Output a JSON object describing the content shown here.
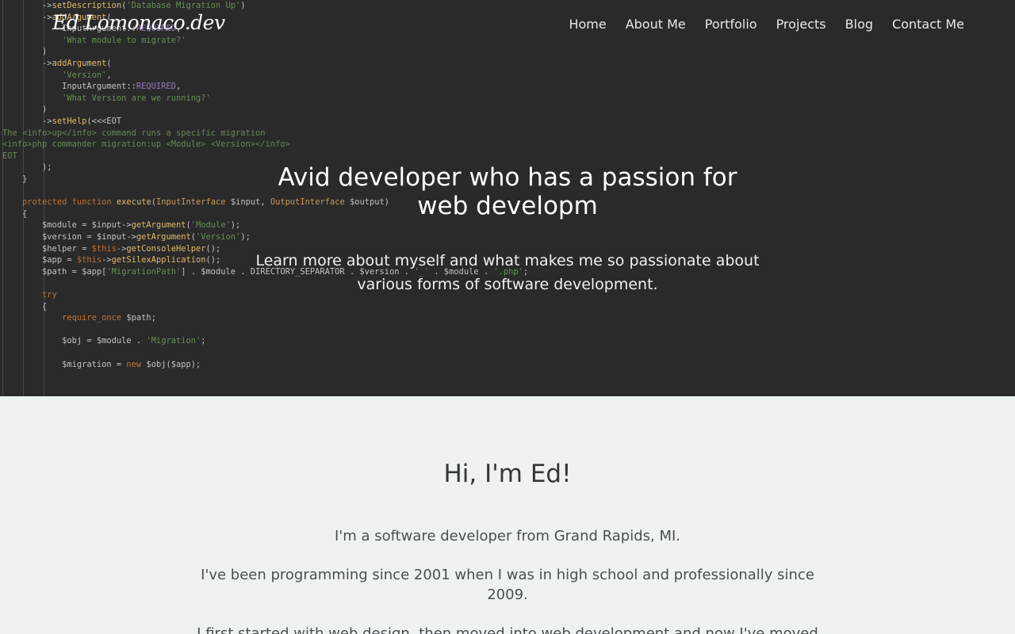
{
  "header": {
    "logo": "Ed Lomonaco.dev",
    "nav": [
      "Home",
      "About Me",
      "Portfolio",
      "Projects",
      "Blog",
      "Contact Me"
    ]
  },
  "hero": {
    "title": "Avid developer who has a passion for web developm",
    "subtitle": "Learn more about myself and what makes me so passionate about various forms of software development."
  },
  "about": {
    "heading": "Hi, I'm Ed!",
    "paragraphs": [
      "I'm a software developer from Grand Rapids, MI.",
      "I've been programming since 2001 when I was in high school and professionally since 2009.",
      "I first started with web design, then moved into web development and now I've moved onto"
    ]
  },
  "code": [
    "        ->setDescription('Database Migration Up')",
    "        ->addArgument(",
    "            InputArgument::REQUIRED,",
    "            'What module to migrate?'",
    "        )",
    "        ->addArgument(",
    "            'Version',",
    "            InputArgument::REQUIRED,",
    "            'What Version are we running?'",
    "        )",
    "        ->setHelp(<<<EOT",
    "The <info>up</info> command runs a specific migration",
    "<info>php commander migration:up <Module> <Version></info>",
    "EOT",
    "        );",
    "    }",
    "",
    "    protected function execute(InputInterface $input, OutputInterface $output)",
    "    {",
    "        $module = $input->getArgument('Module');",
    "        $version = $input->getArgument('Version');",
    "        $helper = $this->getConsoleHelper();",
    "        $app = $this->getSilexApplication();",
    "        $path = $app['MigrationPath'] . $module . DIRECTORY_SEPARATOR . $version . '_' . $module . '.php';",
    "",
    "        try",
    "        {",
    "            require_once $path;",
    "",
    "            $obj = $module . 'Migration';",
    "",
    "            $migration = new $obj($app);",
    ""
  ]
}
